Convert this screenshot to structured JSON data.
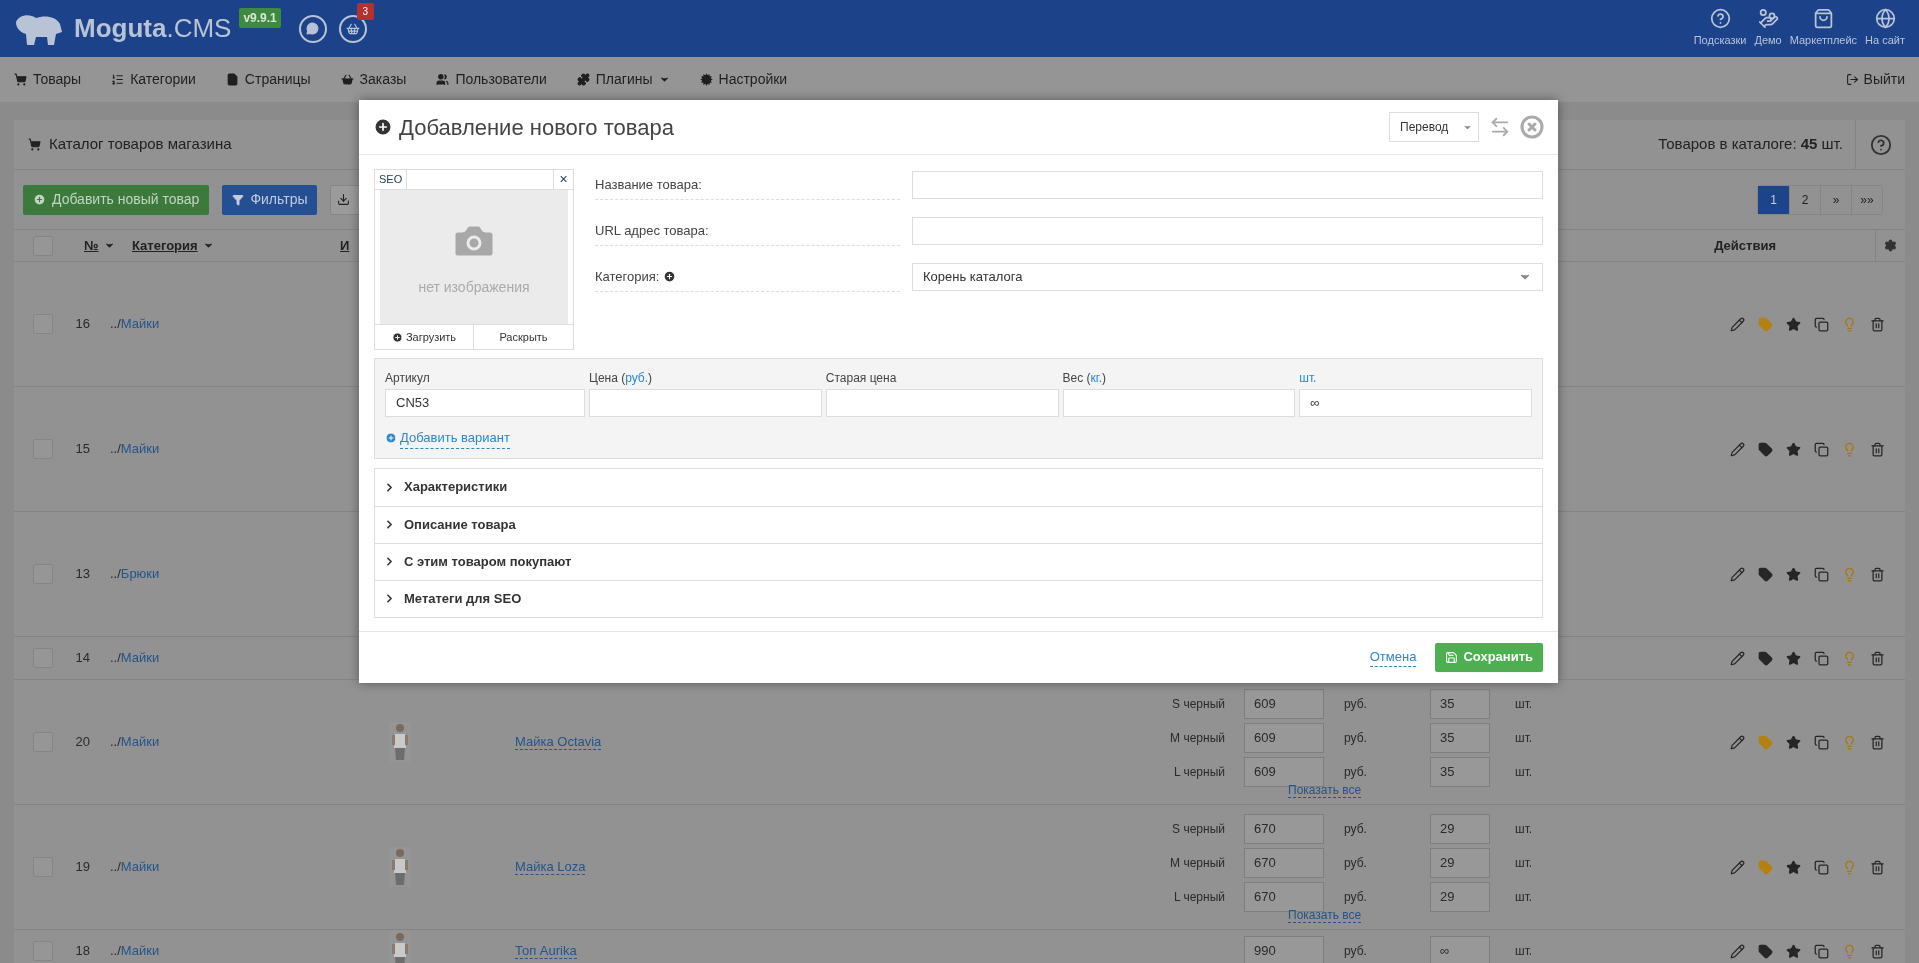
{
  "header": {
    "logo_name": "Moguta",
    "logo_suffix": ".CMS",
    "version": "v9.9.1",
    "cart_badge": "3",
    "links": [
      {
        "kind": "help",
        "label": "Подсказки"
      },
      {
        "kind": "demo",
        "label": "Демо"
      },
      {
        "kind": "market",
        "label": "Маркетплейс"
      },
      {
        "kind": "site",
        "label": "На сайт"
      }
    ]
  },
  "nav": {
    "items": [
      {
        "kind": "products",
        "label": "Товары",
        "dropdown": false
      },
      {
        "kind": "categories",
        "label": "Категории",
        "dropdown": false
      },
      {
        "kind": "pages",
        "label": "Страницы",
        "dropdown": false
      },
      {
        "kind": "orders",
        "label": "Заказы",
        "dropdown": false
      },
      {
        "kind": "users",
        "label": "Пользователи",
        "dropdown": false
      },
      {
        "kind": "plugins",
        "label": "Плагины",
        "dropdown": true
      },
      {
        "kind": "settings",
        "label": "Настройки",
        "dropdown": false
      }
    ],
    "logout": "Выйти"
  },
  "catalog": {
    "title": "Каталог товаров магазина",
    "count": "Товаров в каталоге: **45** шт.",
    "add_button": "Добавить новый товар",
    "filter_button": "Фильтры",
    "pages": [
      {
        "label": "1",
        "selected": true
      },
      {
        "label": "2",
        "selected": false
      },
      {
        "label": "»",
        "selected": false
      },
      {
        "label": "»»",
        "selected": false
      }
    ],
    "select_all_checked": false,
    "columns": [
      {
        "label": "№",
        "sortable": true
      },
      {
        "label": "Категория",
        "sortable": true
      },
      {
        "label": "И",
        "sortable": false
      }
    ],
    "actions_column": "Действия",
    "rows": [
      {
        "checked": false,
        "num": "16",
        "category_path": "../",
        "category": "Майки",
        "kind": "multi",
        "tag_on": true
      },
      {
        "checked": false,
        "num": "15",
        "category_path": "../",
        "category": "Майки",
        "kind": "multi",
        "tag_on": false
      },
      {
        "checked": false,
        "num": "13",
        "category_path": "../",
        "category": "Брюки",
        "kind": "multi",
        "tag_on": false
      },
      {
        "checked": false,
        "num": "14",
        "category_path": "../",
        "category": "Майки",
        "kind": "single",
        "tag_on": false
      },
      {
        "checked": false,
        "num": "20",
        "category_path": "../",
        "category": "Майки",
        "kind": "multi",
        "tag_on": true,
        "product": {
          "name": "Майка Octavia",
          "show_all": "Показать все",
          "variants": [
            {
              "name": "S черный",
              "price": "609",
              "currency": "руб.",
              "qty": "35",
              "unit": "шт."
            },
            {
              "name": "M черный",
              "price": "609",
              "currency": "руб.",
              "qty": "35",
              "unit": "шт."
            },
            {
              "name": "L черный",
              "price": "609",
              "currency": "руб.",
              "qty": "35",
              "unit": "шт."
            }
          ]
        }
      },
      {
        "checked": false,
        "num": "19",
        "category_path": "../",
        "category": "Майки",
        "kind": "multi",
        "tag_on": true,
        "product": {
          "name": "Майка Loza",
          "show_all": "Показать все",
          "variants": [
            {
              "name": "S черный",
              "price": "670",
              "currency": "руб.",
              "qty": "29",
              "unit": "шт."
            },
            {
              "name": "M черный",
              "price": "670",
              "currency": "руб.",
              "qty": "29",
              "unit": "шт."
            },
            {
              "name": "L черный",
              "price": "670",
              "currency": "руб.",
              "qty": "29",
              "unit": "шт."
            }
          ]
        }
      },
      {
        "checked": false,
        "num": "18",
        "category_path": "../",
        "category": "Майки",
        "kind": "single",
        "tag_on": false,
        "product": {
          "name": "Топ Aurika",
          "variants": [
            {
              "price": "990",
              "currency": "руб.",
              "qty": "∞",
              "unit": "шт."
            }
          ]
        }
      }
    ]
  },
  "modal": {
    "title": "Добавление нового товара",
    "translate": "Перевод",
    "image": {
      "seo": "SEO",
      "remove": "×",
      "empty": "нет изображения",
      "upload": "Загрузить",
      "expand": "Раскрыть"
    },
    "fields": [
      {
        "kind": "text",
        "label": "Название товара:"
      },
      {
        "kind": "text",
        "label": "URL адрес товара:"
      },
      {
        "kind": "select",
        "label": "Категория:",
        "value": "Корень каталога"
      }
    ],
    "variant_columns": [
      {
        "label": "Артикул",
        "value": "CN53"
      },
      {
        "label": "Цена (",
        "unit": "руб.",
        "suffix": ")"
      },
      {
        "label": "Старая цена"
      },
      {
        "label": "Вес (",
        "unit": "кг.",
        "suffix": ")"
      },
      {
        "unit": "шт.",
        "value": "∞"
      }
    ],
    "add_variant": "Добавить вариант",
    "sections": [
      {
        "label": "Характеристики",
        "expanded": false
      },
      {
        "label": "Описание товара",
        "expanded": false
      },
      {
        "label": "С этим товаром покупают",
        "expanded": false
      },
      {
        "label": "Метатеги для SEO",
        "expanded": false
      }
    ],
    "cancel": "Отмена",
    "save": "Сохранить"
  }
}
